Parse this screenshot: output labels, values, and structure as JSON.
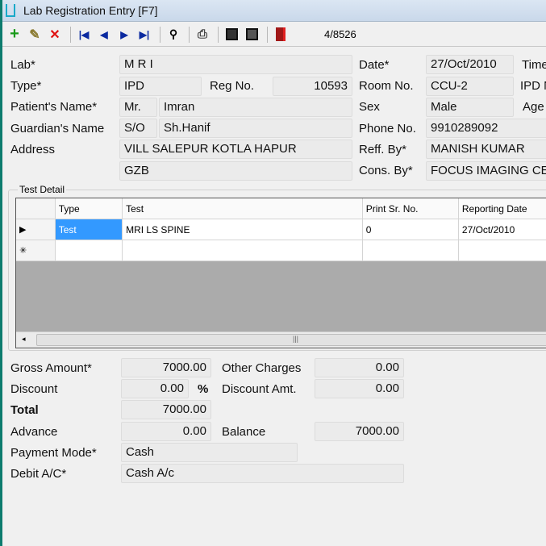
{
  "window": {
    "title": "Lab Registration Entry [F7]"
  },
  "toolbar": {
    "record_counter": "4/8526",
    "icons": [
      "add-icon",
      "edit-icon",
      "delete-icon",
      "first-icon",
      "previous-icon",
      "next-icon",
      "last-icon",
      "find-icon",
      "print-icon",
      "save-icon",
      "save-close-icon",
      "exit-icon"
    ]
  },
  "form": {
    "lab_label": "Lab*",
    "lab": "M R I",
    "date_label": "Date*",
    "date": "27/Oct/2010",
    "time_label": "Time",
    "type_label": "Type*",
    "type": "IPD",
    "reg_label": "Reg No.",
    "reg_no": "10593",
    "room_label": "Room No.",
    "room": "CCU-2",
    "ipd_label": "IPD N",
    "patient_label": "Patient's Name*",
    "title": "Mr.",
    "patient_name": "Imran",
    "sex_label": "Sex",
    "sex": "Male",
    "age_label": "Age",
    "guardian_label": "Guardian's Name",
    "relation": "S/O",
    "guardian": "Sh.Hanif",
    "phone_label": "Phone No.",
    "phone": "9910289092",
    "address_label": "Address",
    "address1": "VILL SALEPUR KOTLA HAPUR",
    "address2": "GZB",
    "reff_label": "Reff. By*",
    "reff_by": "MANISH KUMAR",
    "cons_label": "Cons. By*",
    "cons_by": "FOCUS IMAGING CE"
  },
  "test_detail": {
    "title": "Test Detail",
    "columns": [
      "Type",
      "Test",
      "Print Sr. No.",
      "Reporting Date"
    ],
    "rows": [
      {
        "type": "Test",
        "test": "MRI LS SPINE",
        "print_sr": "0",
        "reporting_date": "27/Oct/2010"
      }
    ],
    "selected_row_marker": "▶",
    "new_row_marker": "✳"
  },
  "billing": {
    "gross_label": "Gross Amount*",
    "gross": "7000.00",
    "other_label": "Other Charges",
    "other": "0.00",
    "discount_label": "Discount",
    "discount": "0.00",
    "percent": "%",
    "discount_amt_label": "Discount Amt.",
    "discount_amt": "0.00",
    "total_label": "Total",
    "total": "7000.00",
    "advance_label": "Advance",
    "advance": "0.00",
    "balance_label": "Balance",
    "balance": "7000.00",
    "payment_label": "Payment Mode*",
    "payment": "Cash",
    "debit_label": "Debit A/C*",
    "debit": "Cash A/c"
  },
  "colors": {
    "selection": "#3399ff",
    "window_edge": "#0d7c6e"
  }
}
